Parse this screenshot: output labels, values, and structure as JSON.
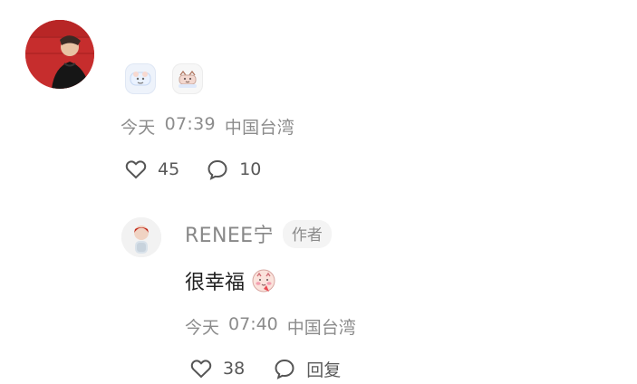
{
  "main_comment": {
    "date": "今天",
    "time": "07:39",
    "location": "中国台湾",
    "likes": "45",
    "comments": "10",
    "stickers": [
      "bear-sticker",
      "cat-sticker"
    ]
  },
  "reply": {
    "name": "RENEE宁",
    "badge": "作者",
    "text": "很幸福",
    "date": "今天",
    "time": "07:40",
    "location": "中国台湾",
    "likes": "38",
    "reply_label": "回复"
  }
}
